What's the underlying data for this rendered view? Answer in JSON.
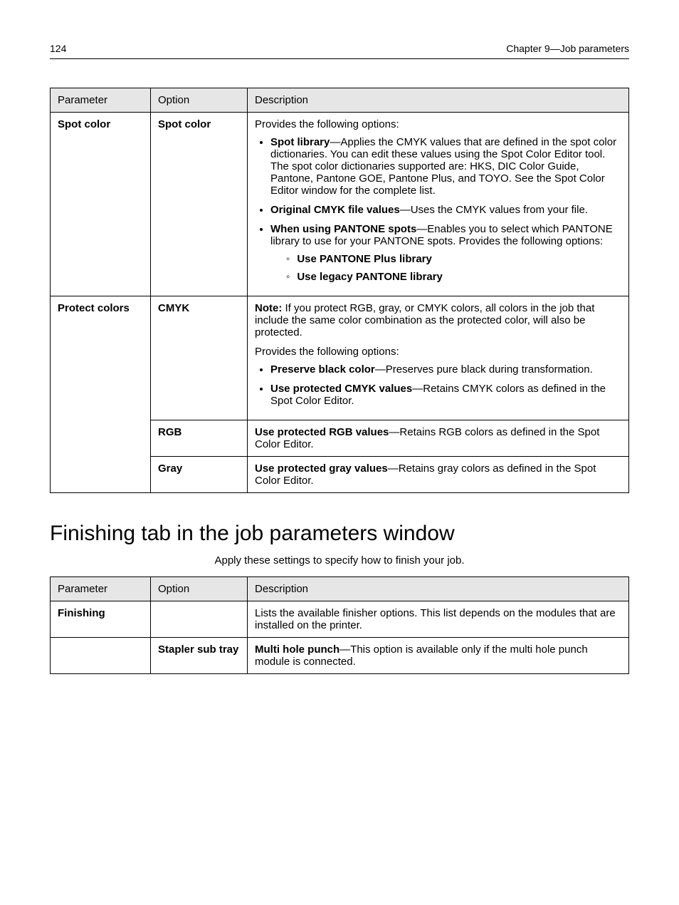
{
  "header": {
    "page_number": "124",
    "chapter": "Chapter 9—Job parameters"
  },
  "table1": {
    "headers": {
      "param": "Parameter",
      "option": "Option",
      "desc": "Description"
    },
    "rows": [
      {
        "param": "Spot color",
        "option": "Spot color",
        "lead": "Provides the following options:",
        "items": [
          {
            "bold": "Spot library",
            "rest": "—Applies the CMYK values that are defined in the spot color dictionaries. You can edit these values using the Spot Color Editor tool. The spot color dictionaries supported are: HKS, DIC Color Guide, Pantone, Pantone GOE, Pantone Plus, and TOYO. See the Spot Color Editor window for the complete list."
          },
          {
            "bold": "Original CMYK file values",
            "rest": "—Uses the CMYK values from your file."
          },
          {
            "bold": "When using PANTONE spots",
            "rest": "—Enables you to select which PANTONE library to use for your PANTONE spots. Provides the following options:",
            "sub": [
              {
                "bold": "Use PANTONE Plus library"
              },
              {
                "bold": "Use legacy PANTONE library"
              }
            ]
          }
        ]
      },
      {
        "param": "Protect colors",
        "option": "CMYK",
        "note_label": "Note:",
        "note_rest": " If you protect RGB, gray, or CMYK colors, all colors in the job that include the same color combination as the protected color, will also be protected.",
        "lead2": "Provides the following options:",
        "items": [
          {
            "bold": "Preserve black color",
            "rest": "—Preserves pure black during transformation."
          },
          {
            "bold": "Use protected CMYK values",
            "rest": "—Retains CMYK colors as defined in the Spot Color Editor."
          }
        ]
      },
      {
        "param": "",
        "option": "RGB",
        "text_bold": "Use protected RGB values",
        "text_rest": "—Retains RGB colors as defined in the Spot Color Editor."
      },
      {
        "param": "",
        "option": "Gray",
        "text_bold": "Use protected gray values",
        "text_rest": "—Retains gray colors as defined in the Spot Color Editor."
      }
    ]
  },
  "section_heading": "Finishing tab in the job parameters window",
  "section_sub": "Apply these settings to specify how to finish your job.",
  "table2": {
    "headers": {
      "param": "Parameter",
      "option": "Option",
      "desc": "Description"
    },
    "rows": [
      {
        "param": "Finishing",
        "option": "",
        "text": "Lists the available finisher options. This list depends on the modules that are installed on the printer."
      },
      {
        "param": "",
        "option": "Stapler sub tray",
        "text_bold": "Multi hole punch",
        "text_rest": "—This option is available only if the multi hole punch module is connected."
      }
    ]
  }
}
